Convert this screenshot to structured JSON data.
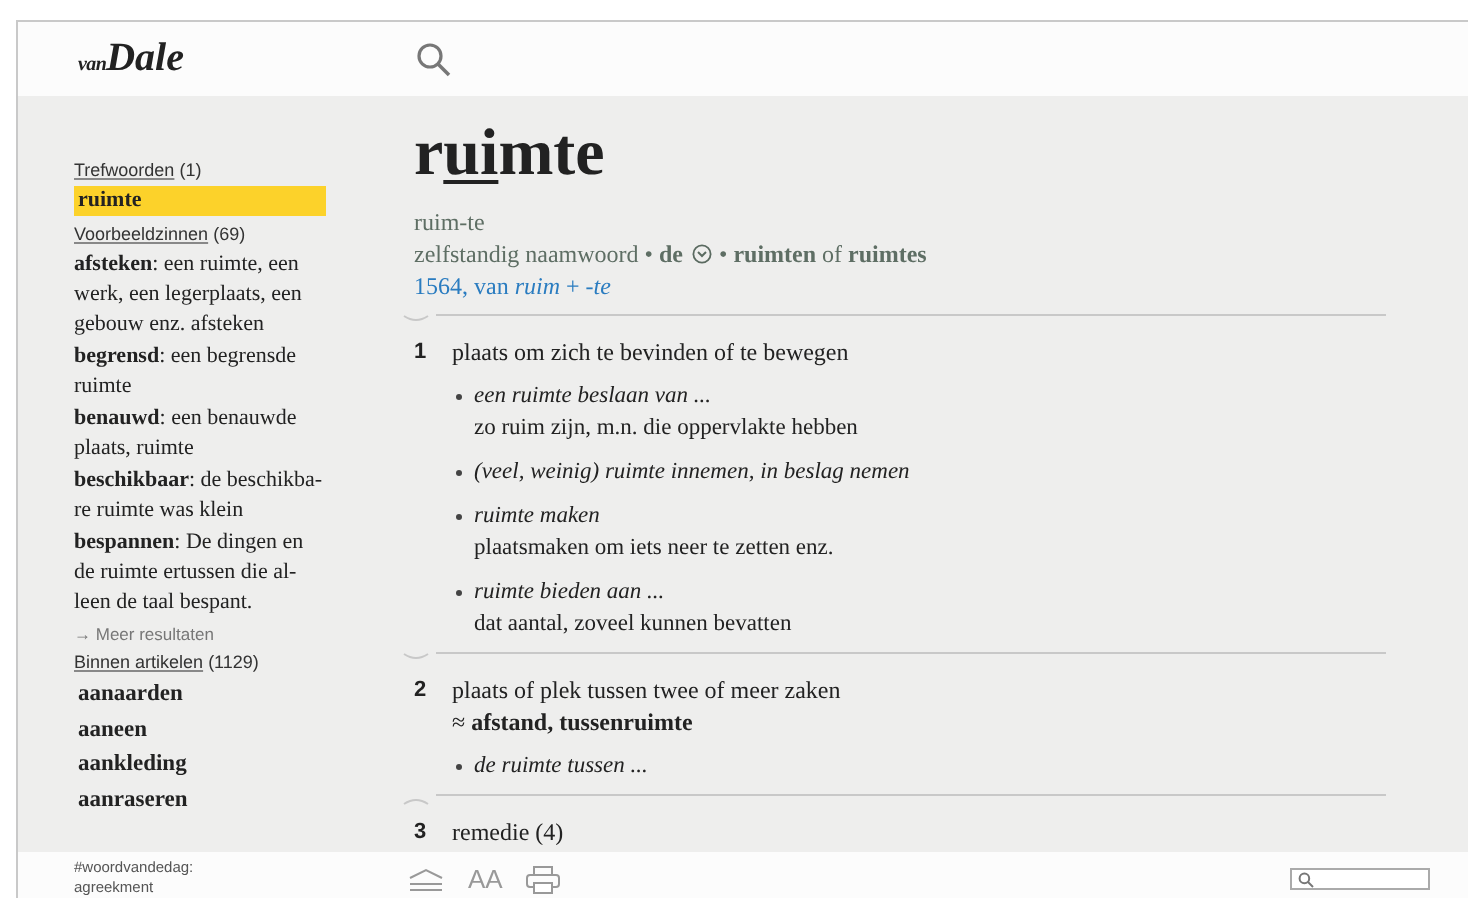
{
  "logo": {
    "small": "van",
    "main": "Dale"
  },
  "sidebar": {
    "sections": [
      {
        "heading": "Trefwoorden",
        "count": "(1)",
        "kind": "words",
        "items": [
          {
            "text": "ruimte",
            "selected": true
          }
        ]
      },
      {
        "heading": "Voorbeeldzinnen",
        "count": "(69)",
        "kind": "sentences",
        "items": [
          {
            "text": "**afsteken**: een ruimte, een werk, een legerplaats, een gebouw enz. afsteken"
          },
          {
            "text": "**begrensd**: een begrensde ruimte"
          },
          {
            "text": "**benauwd**: een benauwde plaats, ruimte"
          },
          {
            "text": "**beschikbaar**: de beschikba-re ruimte was klein"
          },
          {
            "text": "**bespannen**: De dingen en de ruimte ertussen die al-leen de taal bespant."
          }
        ],
        "more": "→ Meer resultaten"
      },
      {
        "heading": "Binnen artikelen",
        "count": "(1129)",
        "kind": "words",
        "items": [
          {
            "text": "aanaarden",
            "selected": false
          },
          {
            "text": "aaneen",
            "selected": false
          },
          {
            "text": "aankleding",
            "selected": false
          },
          {
            "text": "aanraseren",
            "selected": false
          }
        ]
      }
    ]
  },
  "entry": {
    "headword": {
      "before": "r",
      "stressed": "ui",
      "after": "mte"
    },
    "syllables": "ruim-te",
    "grammar_before": "zelfstandig naamwoord • **de**",
    "grammar_after": "• **ruimten** of **ruimtes**",
    "etymology": "1564, van *ruim* + *-te*",
    "senses": [
      {
        "number": "1",
        "definition": "plaats om zich te bevinden of te bewegen",
        "expanded": true,
        "examples": [
          {
            "phrase": "een ruimte beslaan van ...",
            "meaning": "zo ruim zijn, m.n. die oppervlakte hebben"
          },
          {
            "phrase": "(veel, weinig) ruimte innemen, in beslag nemen"
          },
          {
            "phrase": "ruimte maken",
            "meaning": "plaatsmaken om iets neer te zetten enz."
          },
          {
            "phrase": "ruimte bieden aan ...",
            "meaning": "dat aantal, zoveel kunnen bevatten"
          }
        ]
      },
      {
        "number": "2",
        "definition": "plaats of plek tussen twee of meer zaken",
        "synonyms": "≈ **afstand, tussenruimte**",
        "expanded": true,
        "examples": [
          {
            "phrase": "de ruimte tussen ..."
          }
        ]
      },
      {
        "number": "3",
        "definition": "remedie (4)",
        "expanded": false
      }
    ]
  },
  "footer": {
    "word_of_day": "#woordvandedag:",
    "word": "agreekment",
    "font_size_label": "AA"
  }
}
